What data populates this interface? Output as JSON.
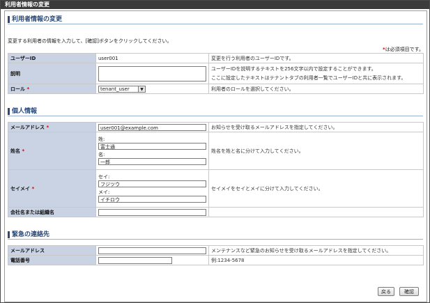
{
  "window": {
    "title": "利用者情報の変更"
  },
  "page": {
    "heading": "利用者情報の変更",
    "intro": "変更する利用者の情報を入力して、[確認]ボタンをクリックしてください。",
    "required_mark": "*",
    "required_note": "は必須項目です。"
  },
  "basic": {
    "user_id_label": "ユーザーID",
    "user_id_value": "user001",
    "user_id_desc": "変更を行う利用者のユーザーIDです。",
    "description_label": "説明",
    "description_desc_1": "ユーザーIDを説明するテキストを256文字以内で設定することができます。",
    "description_desc_2": "ここに設定したテキストはテナントタブの利用者一覧でユーザーIDと共に表示されます。",
    "role_label": "ロール",
    "role_value": "tenant_user",
    "role_desc": "利用者のロールを選択してください。"
  },
  "personal": {
    "heading": "個人情報",
    "email_label": "メールアドレス",
    "email_value": "user001@example.com",
    "email_desc": "お知らせを受け取るメールアドレスを指定してください。",
    "name_label": "姓名",
    "last_name_caption": "姓:",
    "last_name_value": "富士通",
    "first_name_caption": "名:",
    "first_name_value": "一郎",
    "name_desc": "姓名を姓と名に分けて入力してください。",
    "kana_label": "セイメイ",
    "last_kana_caption": "セイ:",
    "last_kana_value": "フジツウ",
    "first_kana_caption": "メイ:",
    "first_kana_value": "イチロウ",
    "kana_desc": "セイメイをセイとメイに分けて入力してください。",
    "company_label": "会社名または組織名",
    "company_value": ""
  },
  "emergency": {
    "heading": "緊急の連絡先",
    "email_label": "メールアドレス",
    "email_value": "",
    "email_desc": "メンテナンスなど緊急のお知らせを受け取るメールアドレスを指定してください。",
    "phone_label": "電話番号",
    "phone_value": "",
    "phone_desc": "例:1234-5678"
  },
  "buttons": {
    "back": "戻る",
    "confirm": "確認"
  }
}
